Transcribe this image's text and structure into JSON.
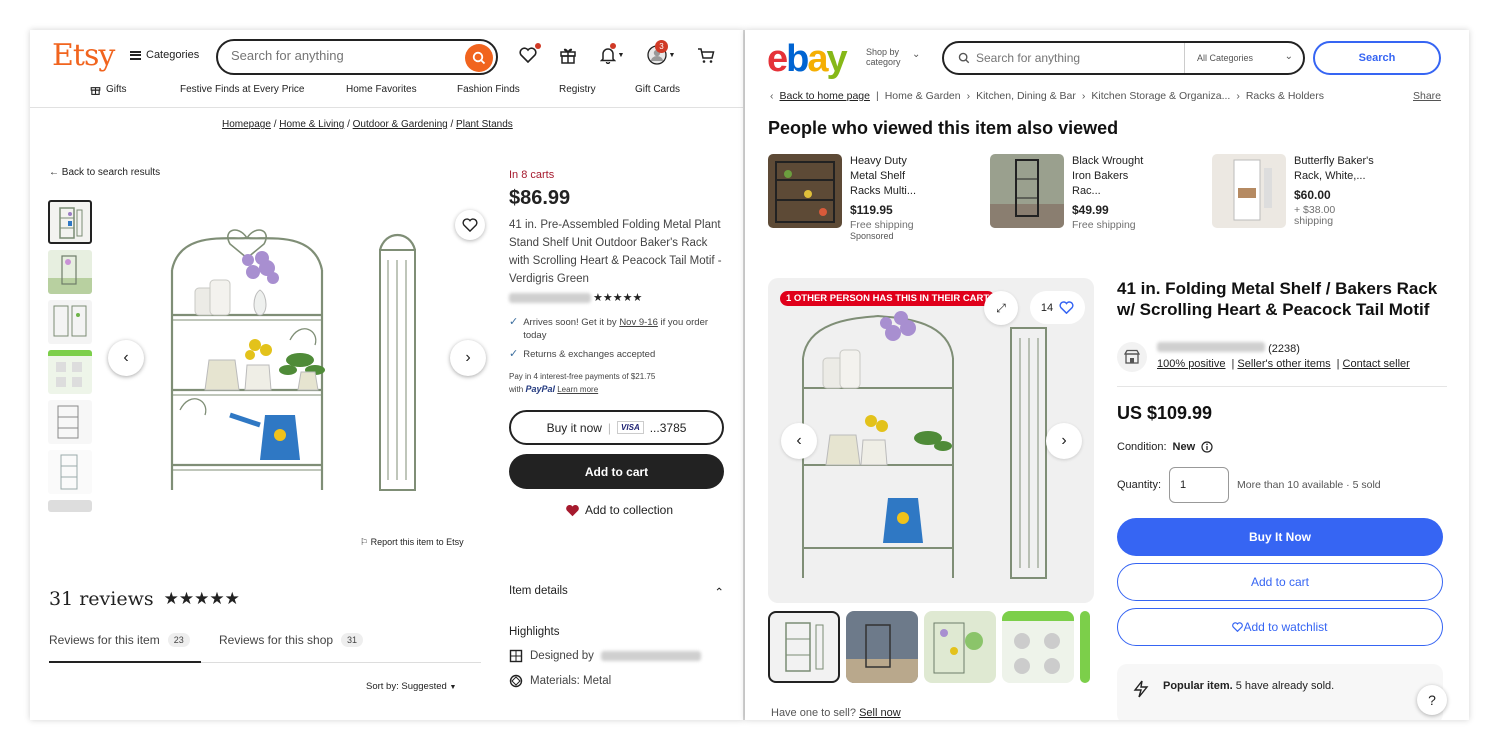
{
  "etsy": {
    "logo": "Etsy",
    "categories_label": "Categories",
    "search_placeholder": "Search for anything",
    "cart_badge": "3",
    "nav": [
      "Gifts",
      "Festive Finds at Every Price",
      "Home Favorites",
      "Fashion Finds",
      "Registry",
      "Gift Cards"
    ],
    "breadcrumb": [
      "Homepage",
      "Home & Living",
      "Outdoor & Gardening",
      "Plant Stands"
    ],
    "breadcrumb_sep": "/",
    "back": "Back to search results",
    "in_carts": "In 8 carts",
    "price": "$86.99",
    "title": "41 in. Pre-Assembled Folding Metal Plant Stand Shelf Unit Outdoor Baker's Rack with Scrolling Heart & Peacock Tail Motif - Verdigris Green",
    "shop_stars": "★★★★★",
    "arrives": "Arrives soon! Get it by",
    "arrives_date": "Nov 9-16",
    "arrives_tail": "if you order today",
    "returns": "Returns & exchanges accepted",
    "pay_line1": "Pay in 4 interest-free payments of $21.75",
    "pay_with": "with",
    "paypal": "PayPal",
    "learn_more": "Learn more",
    "buy_now": "Buy it now",
    "card_separator": "|",
    "visa": "VISA",
    "card_last": "...3785",
    "add_to_cart": "Add to cart",
    "add_to_collection": "Add to collection",
    "report": "Report this item to Etsy",
    "reviews_count": "31 reviews",
    "reviews_stars": "★★★★★",
    "tab_item": "Reviews for this item",
    "tab_item_count": "23",
    "tab_shop": "Reviews for this shop",
    "tab_shop_count": "31",
    "sort": "Sort by: Suggested",
    "item_details": "Item details",
    "highlights": "Highlights",
    "designed_by": "Designed by",
    "materials": "Materials: Metal"
  },
  "ebay": {
    "shop_by": "Shop by",
    "category": "category",
    "search_placeholder": "Search for anything",
    "all_categories": "All Categories",
    "search_btn": "Search",
    "breadcrumb": [
      "Back to home page",
      "Home & Garden",
      "Kitchen, Dining & Bar",
      "Kitchen Storage & Organiza...",
      "Racks & Holders"
    ],
    "share": "Share",
    "also_viewed": "People who viewed this item also viewed",
    "cards": [
      {
        "title": "Heavy Duty Metal Shelf Racks Multi...",
        "price": "$119.95",
        "shipping": "Free shipping",
        "note": "Sponsored"
      },
      {
        "title": "Black Wrought Iron Bakers Rac...",
        "price": "$49.99",
        "shipping": "Free shipping",
        "note": ""
      },
      {
        "title": "Butterfly Baker's Rack, White,...",
        "price": "$60.00",
        "shipping": "+ $38.00 shipping",
        "note": ""
      }
    ],
    "cart_flag": "1 OTHER PERSON HAS THIS IN THEIR CART",
    "watch_count": "14",
    "have_one": "Have one to sell?",
    "sell_now": "Sell now",
    "title": "41 in. Folding Metal Shelf / Bakers Rack w/ Scrolling Heart & Peacock Tail Motif",
    "feedback_count": "(2238)",
    "positive": "100% positive",
    "other_items": "Seller's other items",
    "contact": "Contact seller",
    "price": "US $109.99",
    "condition_label": "Condition:",
    "condition": "New",
    "quantity_label": "Quantity:",
    "quantity": "1",
    "availability": "More than 10 available · 5 sold",
    "buy_it_now": "Buy It Now",
    "add_to_cart": "Add to cart",
    "add_to_watchlist": "Add to watchlist",
    "popular_bold": "Popular item.",
    "popular_rest": " 5 have already sold.",
    "help": "?"
  },
  "colors": {
    "etsy_orange": "#f1641e",
    "ebay_blue": "#3665f3",
    "cart_red": "#e0001b"
  }
}
